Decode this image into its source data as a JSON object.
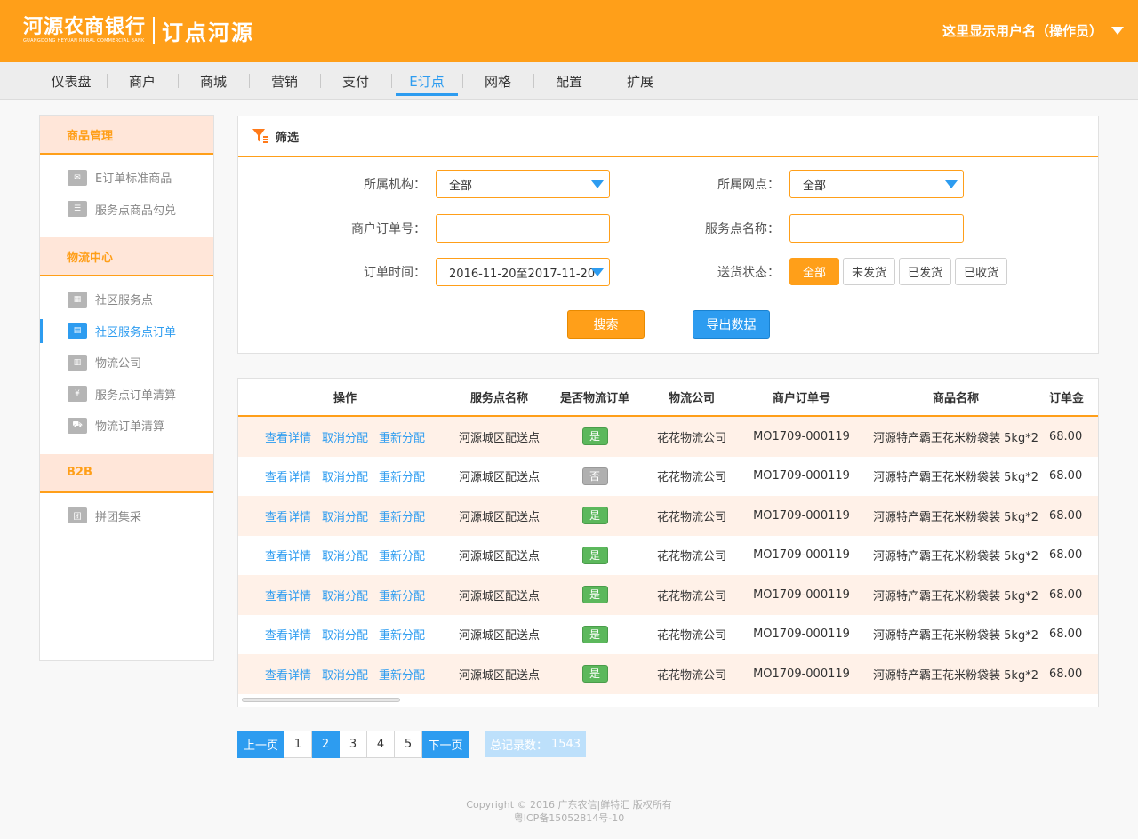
{
  "header": {
    "bank_name": "河源农商银行",
    "bank_en": "GUANGDONG HEYUAN RURAL COMMERCIAL BANK",
    "sub_title": "订点河源",
    "user_label": "这里显示用户名（操作员）"
  },
  "nav": {
    "items": [
      "仪表盘",
      "商户",
      "商城",
      "营销",
      "支付",
      "E订点",
      "网格",
      "配置",
      "扩展"
    ],
    "active": "E订点"
  },
  "sidebar": {
    "groups": [
      {
        "title": "商品管理",
        "items": [
          {
            "label": "E订单标准商品",
            "icon": "envelope-icon"
          },
          {
            "label": "服务点商品勾兑",
            "icon": "list-icon"
          }
        ]
      },
      {
        "title": "物流中心",
        "items": [
          {
            "label": "社区服务点",
            "icon": "store-icon"
          },
          {
            "label": "社区服务点订单",
            "icon": "order-icon",
            "active": true
          },
          {
            "label": "物流公司",
            "icon": "building-icon"
          },
          {
            "label": "服务点订单清算",
            "icon": "yen-icon"
          },
          {
            "label": "物流订单清算",
            "icon": "truck-icon"
          }
        ]
      },
      {
        "title": "B2B",
        "items": [
          {
            "label": "拼团集采",
            "icon": "group-icon"
          }
        ]
      }
    ]
  },
  "filter": {
    "title": "筛选",
    "org_label": "所属机构：",
    "org_value": "全部",
    "outlet_label": "所属网点：",
    "outlet_value": "全部",
    "merchant_order_label": "商户订单号：",
    "merchant_order_value": "",
    "service_point_label": "服务点名称：",
    "service_point_value": "",
    "order_time_label": "订单时间：",
    "order_time_value": "2016-11-20至2017-11-20",
    "delivery_label": "送货状态：",
    "delivery_options": [
      "全部",
      "未发货",
      "已发货",
      "已收货"
    ],
    "delivery_active": "全部",
    "search_label": "搜索",
    "export_label": "导出数据"
  },
  "table": {
    "columns": [
      "操作",
      "服务点名称",
      "是否物流订单",
      "物流公司",
      "商户订单号",
      "商品名称",
      "订单金"
    ],
    "ops": [
      "查看详情",
      "取消分配",
      "重新分配"
    ],
    "rows": [
      {
        "service_point": "河源城区配送点",
        "is_logistics": "是",
        "company": "花花物流公司",
        "order_no": "MO1709-000119",
        "product": "河源特产霸王花米粉袋装 5kg*2",
        "amount": "68.00"
      },
      {
        "service_point": "河源城区配送点",
        "is_logistics": "否",
        "company": "花花物流公司",
        "order_no": "MO1709-000119",
        "product": "河源特产霸王花米粉袋装 5kg*2",
        "amount": "68.00"
      },
      {
        "service_point": "河源城区配送点",
        "is_logistics": "是",
        "company": "花花物流公司",
        "order_no": "MO1709-000119",
        "product": "河源特产霸王花米粉袋装 5kg*2",
        "amount": "68.00"
      },
      {
        "service_point": "河源城区配送点",
        "is_logistics": "是",
        "company": "花花物流公司",
        "order_no": "MO1709-000119",
        "product": "河源特产霸王花米粉袋装 5kg*2",
        "amount": "68.00"
      },
      {
        "service_point": "河源城区配送点",
        "is_logistics": "是",
        "company": "花花物流公司",
        "order_no": "MO1709-000119",
        "product": "河源特产霸王花米粉袋装 5kg*2",
        "amount": "68.00"
      },
      {
        "service_point": "河源城区配送点",
        "is_logistics": "是",
        "company": "花花物流公司",
        "order_no": "MO1709-000119",
        "product": "河源特产霸王花米粉袋装 5kg*2",
        "amount": "68.00"
      },
      {
        "service_point": "河源城区配送点",
        "is_logistics": "是",
        "company": "花花物流公司",
        "order_no": "MO1709-000119",
        "product": "河源特产霸王花米粉袋装 5kg*2",
        "amount": "68.00"
      }
    ]
  },
  "pagination": {
    "prev_label": "上一页",
    "pages": [
      "1",
      "2",
      "3",
      "4",
      "5"
    ],
    "current": "2",
    "next_label": "下一页",
    "total_label": "总记录数：",
    "total_value": "1543"
  },
  "footer": {
    "copyright": "Copyright © 2016 广东农信|鲜特汇 版权所有",
    "icp": "粤ICP备15052814号-10"
  },
  "colors": {
    "brand_orange": "#ff9f19",
    "accent_blue": "#2d9cf0",
    "row_alt": "#fff1e8",
    "tag_yes": "#5cb85c",
    "tag_no": "#b0b0b0"
  }
}
